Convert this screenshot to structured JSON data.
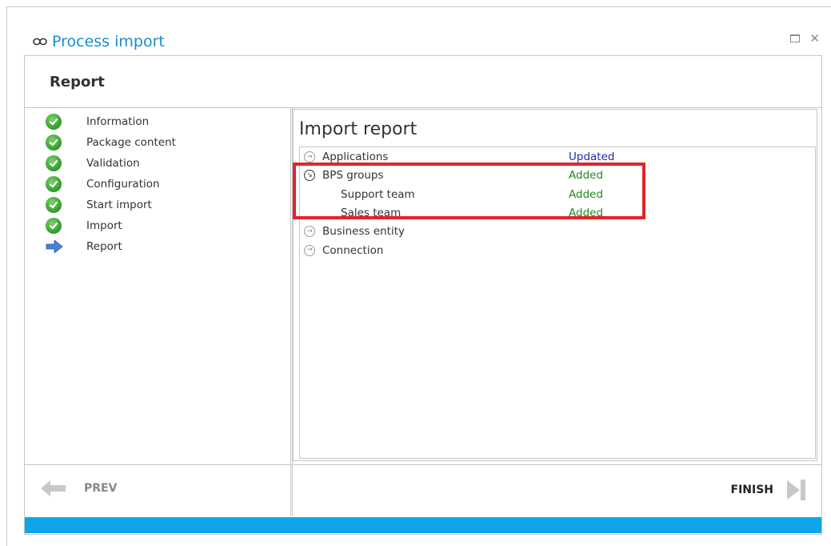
{
  "window": {
    "title": "Process import",
    "title_icon": "link-icon",
    "accent_color": "#1a8dcc"
  },
  "header": {
    "title": "Report"
  },
  "steps": [
    {
      "label": "Information",
      "state": "done",
      "icon": "checkmark-icon"
    },
    {
      "label": "Package content",
      "state": "done",
      "icon": "checkmark-icon"
    },
    {
      "label": "Validation",
      "state": "done",
      "icon": "checkmark-icon"
    },
    {
      "label": "Configuration",
      "state": "done",
      "icon": "checkmark-icon"
    },
    {
      "label": "Start import",
      "state": "done",
      "icon": "checkmark-icon"
    },
    {
      "label": "Import",
      "state": "done",
      "icon": "checkmark-icon"
    },
    {
      "label": "Report",
      "state": "current",
      "icon": "arrow-right-icon"
    }
  ],
  "report": {
    "title": "Import report",
    "rows": [
      {
        "name": "Applications",
        "status": "Updated",
        "status_color": "#1f2fa0",
        "level": 0,
        "expanded": false
      },
      {
        "name": "BPS groups",
        "status": "Added",
        "status_color": "#1e8a1e",
        "level": 0,
        "expanded": true
      },
      {
        "name": "Support team",
        "status": "Added",
        "status_color": "#1e8a1e",
        "level": 1,
        "expanded": false
      },
      {
        "name": "Sales team",
        "status": "Added",
        "status_color": "#1e8a1e",
        "level": 1,
        "expanded": false
      },
      {
        "name": "Business entity",
        "status": "",
        "status_color": "",
        "level": 0,
        "expanded": false
      },
      {
        "name": "Connection",
        "status": "",
        "status_color": "",
        "level": 0,
        "expanded": false
      }
    ],
    "highlight_color": "#e3242b"
  },
  "footer": {
    "prev_label": "PREV",
    "finish_label": "FINISH"
  },
  "progress": {
    "fraction": 1.0,
    "color": "#0ea5ea"
  }
}
